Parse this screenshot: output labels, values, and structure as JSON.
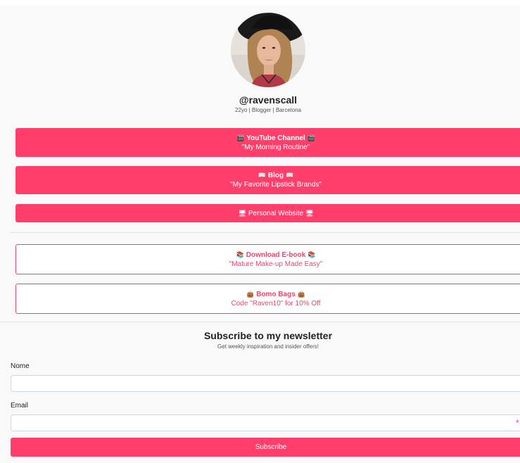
{
  "profile": {
    "handle": "@ravenscall",
    "bio": "22yo | Blogger | Barcelona"
  },
  "links": [
    {
      "title": "YouTube Channel",
      "subtitle": "\"My Morning Routine\"",
      "icon_glyph": "🎬",
      "icon": "clapper-icon",
      "style": "solid"
    },
    {
      "title": "Blog",
      "subtitle": "\"My Favorite Lipstick Brands\"",
      "icon_glyph": "📖",
      "icon": "book-icon",
      "style": "solid"
    },
    {
      "title": "Personal Website",
      "icon_glyph": "🖥",
      "icon": "desktop-computer-icon",
      "style": "solid"
    },
    {
      "title": "Download E-book",
      "subtitle": "\"Mature Make-up Made Easy\"",
      "icon_glyph": "📚",
      "icon": "books-icon",
      "style": "outline"
    },
    {
      "title": "Bomo Bags",
      "subtitle": "Code \"Raven10\" for 10% Off",
      "icon_glyph": "👜",
      "icon": "handbag-icon",
      "style": "outline"
    }
  ],
  "newsletter": {
    "title": "Subscribe to my newsletter",
    "subtitle": "Get weekly inspiration and insider offers!",
    "name_label": "Nome",
    "name_value": "",
    "email_label": "Email",
    "email_value": "",
    "required_marker": "*",
    "submit_label": "Subscribe"
  },
  "colors": {
    "accent": "#ff3e6c",
    "outline": "#e8476e",
    "background": "#f9f9f9"
  }
}
